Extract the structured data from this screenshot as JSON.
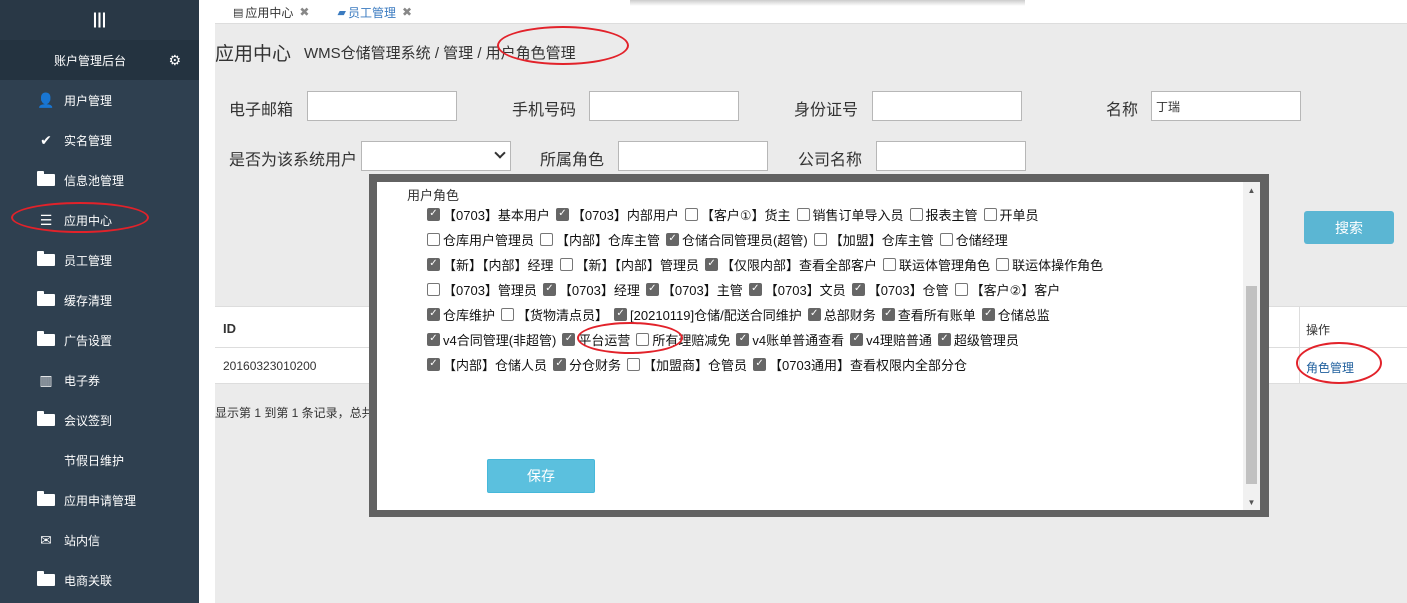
{
  "sidebar": {
    "top_icon": "|||",
    "brand": "账户管理后台",
    "items": [
      {
        "label": "用户管理",
        "icon": "user-icon"
      },
      {
        "label": "实名管理",
        "icon": "check-icon"
      },
      {
        "label": "信息池管理",
        "icon": "folder-open-icon"
      },
      {
        "label": "应用中心",
        "icon": "server-icon"
      },
      {
        "label": "员工管理",
        "icon": "folder-open-icon"
      },
      {
        "label": "缓存清理",
        "icon": "folder-open-icon"
      },
      {
        "label": "广告设置",
        "icon": "folder-open-icon"
      },
      {
        "label": "电子券",
        "icon": "bar-chart-icon"
      },
      {
        "label": "会议签到",
        "icon": "folder-open-icon"
      },
      {
        "label": "节假日维护",
        "icon": ""
      },
      {
        "label": "应用申请管理",
        "icon": "folder-open-icon"
      },
      {
        "label": "站内信",
        "icon": "envelope-icon"
      },
      {
        "label": "电商关联",
        "icon": "folder-open-icon"
      }
    ]
  },
  "tabs": [
    {
      "label": "应用中心",
      "close": "✖"
    },
    {
      "label": "员工管理",
      "close": "✖"
    }
  ],
  "page": {
    "title": "应用中心",
    "breadcrumb": "WMS仓储管理系统 / 管理 / 用户角色管理"
  },
  "filters": {
    "email_label": "电子邮箱",
    "email_value": "",
    "phone_label": "手机号码",
    "phone_value": "",
    "idcard_label": "身份证号",
    "idcard_value": "",
    "name_label": "名称",
    "name_value": "丁瑞",
    "is_system_user_label": "是否为该系统用户",
    "is_system_user_value": "",
    "role_label": "所属角色",
    "role_value": "",
    "company_label": "公司名称",
    "company_value": "",
    "search_label": "搜索"
  },
  "table": {
    "headers": {
      "id": "ID",
      "op": "操作"
    },
    "rows": [
      {
        "id": "20160323010200",
        "op": "角色管理"
      }
    ],
    "footer": "显示第 1 到第 1 条记录，总共"
  },
  "modal": {
    "label": "用户角色",
    "save_label": "保存",
    "roles": [
      [
        {
          "label": "【0703】基本用户",
          "checked": true
        },
        {
          "label": "【0703】内部用户",
          "checked": true
        },
        {
          "label": "【客户①】货主",
          "checked": false
        },
        {
          "label": "销售订单导入员",
          "checked": false
        },
        {
          "label": "报表主管",
          "checked": false
        },
        {
          "label": "开单员",
          "checked": false
        }
      ],
      [
        {
          "label": "仓库用户管理员",
          "checked": false
        },
        {
          "label": "【内部】仓库主管",
          "checked": false
        },
        {
          "label": "仓储合同管理员(超管)",
          "checked": true
        },
        {
          "label": "【加盟】仓库主管",
          "checked": false
        },
        {
          "label": "仓储经理",
          "checked": false
        }
      ],
      [
        {
          "label": "【新】【内部】经理",
          "checked": true
        },
        {
          "label": "【新】【内部】管理员",
          "checked": false
        },
        {
          "label": "【仅限内部】查看全部客户",
          "checked": true
        },
        {
          "label": "联运体管理角色",
          "checked": false
        },
        {
          "label": "联运体操作角色",
          "checked": false
        }
      ],
      [
        {
          "label": "【0703】管理员",
          "checked": false
        },
        {
          "label": "【0703】经理",
          "checked": true
        },
        {
          "label": "【0703】主管",
          "checked": true
        },
        {
          "label": "【0703】文员",
          "checked": true
        },
        {
          "label": "【0703】仓管",
          "checked": true
        },
        {
          "label": "【客户②】客户",
          "checked": false
        }
      ],
      [
        {
          "label": "仓库维护",
          "checked": true
        },
        {
          "label": "【货物清点员】",
          "checked": false
        },
        {
          "label": "[20210119]仓储/配送合同维护",
          "checked": true
        },
        {
          "label": "总部财务",
          "checked": true
        },
        {
          "label": "查看所有账单",
          "checked": true
        },
        {
          "label": "仓储总监",
          "checked": true
        }
      ],
      [
        {
          "label": "v4合同管理(非超管)",
          "checked": true
        },
        {
          "label": "平台运营",
          "checked": true
        },
        {
          "label": "所有理赔减免",
          "checked": false
        },
        {
          "label": "v4账单普通查看",
          "checked": true
        },
        {
          "label": "v4理赔普通",
          "checked": true
        },
        {
          "label": "超级管理员",
          "checked": true
        }
      ],
      [
        {
          "label": "【内部】仓储人员",
          "checked": true
        },
        {
          "label": "分仓财务",
          "checked": true
        },
        {
          "label": "【加盟商】仓管员",
          "checked": false
        },
        {
          "label": "【0703通用】查看权限内全部分仓",
          "checked": true
        }
      ]
    ]
  },
  "colors": {
    "sidebar_bg": "#2f4050",
    "accent": "#5bc0de",
    "annotation": "#e2222a",
    "link": "#1f5f9d"
  }
}
